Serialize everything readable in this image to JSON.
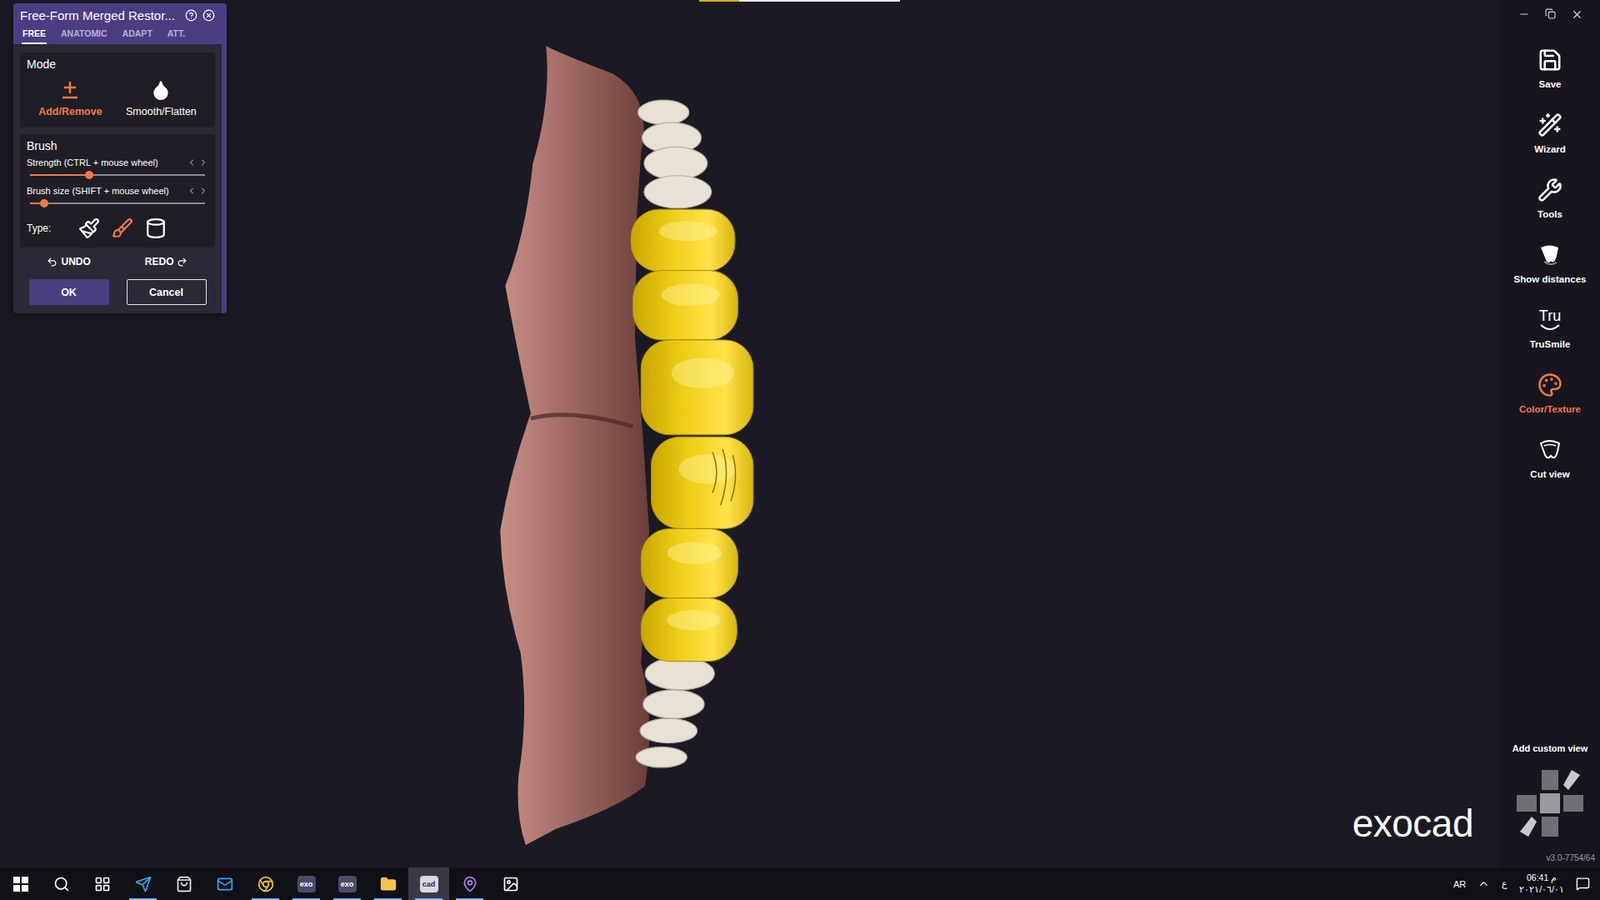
{
  "window": {
    "title": "Free-Form Merged Restor..."
  },
  "panel": {
    "tabs": [
      {
        "label": "FREE",
        "selected": true
      },
      {
        "label": "ANATOMIC",
        "selected": false
      },
      {
        "label": "ADAPT",
        "selected": false
      },
      {
        "label": "ATT.",
        "selected": false
      }
    ],
    "mode": {
      "title": "Mode",
      "options": [
        {
          "label": "Add/Remove",
          "kind": "add",
          "selected": true
        },
        {
          "label": "Smooth/Flatten",
          "kind": "smooth",
          "selected": false
        }
      ]
    },
    "brush": {
      "title": "Brush",
      "sliders": [
        {
          "label": "Strength (CTRL + mouse wheel)",
          "level": 0.34
        },
        {
          "label": "Brush size (SHIFT + mouse wheel)",
          "level": 0.08
        }
      ],
      "type_label": "Type:",
      "types": [
        {
          "kind": "flat",
          "selected": false
        },
        {
          "kind": "round",
          "selected": true
        },
        {
          "kind": "cylinder",
          "selected": false
        }
      ]
    },
    "undo": "UNDO",
    "redo": "REDO",
    "buttons": [
      {
        "label": "OK",
        "primary": true
      },
      {
        "label": "Cancel",
        "primary": false
      }
    ]
  },
  "toolbar": {
    "items": [
      {
        "label": "Save",
        "kind": "save",
        "selected": false,
        "icon_text": ""
      },
      {
        "label": "Wizard",
        "kind": "wizard",
        "selected": false,
        "icon_text": ""
      },
      {
        "label": "Tools",
        "kind": "tools",
        "selected": false,
        "icon_text": ""
      },
      {
        "label": "Show distances",
        "kind": "distances",
        "selected": false,
        "icon_text": ""
      },
      {
        "label": "TruSmile",
        "kind": "trusmile",
        "selected": false,
        "icon_text": "Tru"
      },
      {
        "label": "Color/Texture",
        "kind": "color",
        "selected": true,
        "icon_text": ""
      },
      {
        "label": "Cut view",
        "kind": "cut",
        "selected": false,
        "icon_text": ""
      }
    ],
    "custom_view": "Add custom view",
    "version": "v3.0-7754/64"
  },
  "viewport": {
    "logo": "exocad",
    "progress": {
      "level": 0.2
    }
  },
  "taskbar": {
    "apps": [
      {
        "kind": "start",
        "label": "",
        "running": false,
        "active": false
      },
      {
        "kind": "search",
        "label": "",
        "running": false,
        "active": false
      },
      {
        "kind": "taskview",
        "label": "",
        "running": false,
        "active": false
      },
      {
        "kind": "telegram",
        "label": "",
        "running": true,
        "active": false
      },
      {
        "kind": "store",
        "label": "",
        "running": false,
        "active": false
      },
      {
        "kind": "mail",
        "label": "",
        "running": false,
        "active": false
      },
      {
        "kind": "chrome",
        "label": "",
        "running": true,
        "active": false
      },
      {
        "kind": "badge",
        "label": "exo",
        "running": true,
        "active": false
      },
      {
        "kind": "badge",
        "label": "exo",
        "running": true,
        "active": false
      },
      {
        "kind": "folder",
        "label": "",
        "running": true,
        "active": false
      },
      {
        "kind": "badge",
        "label": "cad",
        "running": true,
        "active": true
      },
      {
        "kind": "maps",
        "label": "",
        "running": true,
        "active": false
      },
      {
        "kind": "photos",
        "label": "",
        "running": false,
        "active": false
      }
    ],
    "tray": {
      "language": "AR",
      "keyboard": "ع",
      "time": "06:41 م",
      "date": "٢٠٢١/٠٦/٠١"
    }
  }
}
